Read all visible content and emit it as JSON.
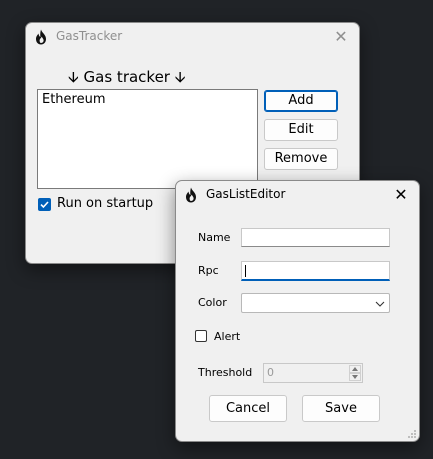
{
  "main": {
    "title": "GasTracker",
    "heading": "🡫 Gas tracker 🡫",
    "list_items": [
      "Ethereum"
    ],
    "buttons": {
      "add": "Add",
      "edit": "Edit",
      "remove": "Remove"
    },
    "run_on_startup": {
      "label": "Run on startup",
      "checked": true
    }
  },
  "editor": {
    "title": "GasListEditor",
    "name_label": "Name",
    "name_value": "",
    "rpc_label": "Rpc",
    "rpc_value": "",
    "color_label": "Color",
    "color_value": "",
    "alert_label": "Alert",
    "alert_checked": false,
    "threshold_label": "Threshold",
    "threshold_value": "0",
    "cancel_label": "Cancel",
    "save_label": "Save"
  },
  "colors": {
    "accent": "#005fb8",
    "backdrop": "#202327",
    "window": "#f0f0f0"
  }
}
